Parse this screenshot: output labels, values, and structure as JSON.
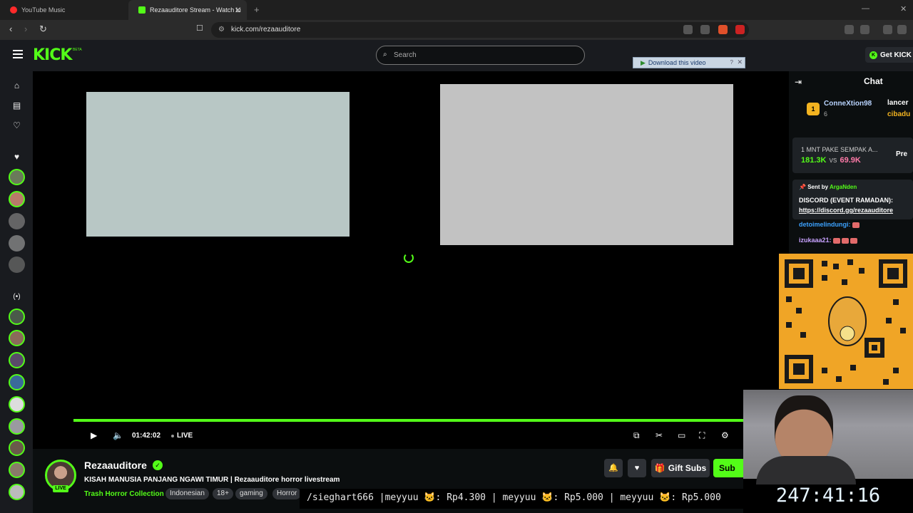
{
  "browser": {
    "tabs": [
      {
        "label": "YouTube Music"
      },
      {
        "label": "Rezaauditore Stream - Watch Li"
      }
    ],
    "url": "kick.com/rezaauditore"
  },
  "header": {
    "logo": "KICK",
    "beta": "BETA",
    "search_placeholder": "Search",
    "download_label": "Download this video",
    "get_kick": "Get KICK"
  },
  "player": {
    "time": "01:42:02",
    "live_label": "LIVE",
    "progress": 1.0
  },
  "stream": {
    "streamer": "Rezaauditore",
    "live_badge": "LIVE",
    "title": "KISAH MANUSIA PANJANG NGAWI TIMUR | Rezaauditore horror livestream",
    "category": "Trash Horror Collection",
    "tags": [
      "Indonesian",
      "18+",
      "gaming",
      "Horror"
    ],
    "gift_label": "Gift Subs",
    "sub_label": "Sub"
  },
  "chat": {
    "title": "Chat",
    "top_gifter": {
      "rank": "1",
      "name": "ConneXtion98",
      "count": "6"
    },
    "gifter2": "lancer",
    "gifter3": "cibadu",
    "prediction": {
      "question": "1 MNT PAKE SEMPAK A...",
      "left": "181.3K",
      "vs": "vs",
      "right": "69.9K",
      "button": "Pre"
    },
    "pinned": {
      "sent_by": "Sent by",
      "user": "ArgaNden",
      "line1": "DISCORD (EVENT RAMADAN):",
      "line2": "https://discord.gg/rezaauditore"
    },
    "messages": [
      {
        "user": "detoimelindungi:"
      },
      {
        "user": "izukaaa21:"
      }
    ]
  },
  "overlay": {
    "ticker": "/sieghart666 |meyyuu 🐱: Rp4.300 | meyyuu 🐱: Rp5.000 | meyyuu 🐱: Rp5.000",
    "clock": "247:41:16"
  },
  "colors": {
    "accent": "#53fc18",
    "bg": "#0b0e0f",
    "panel": "#191b1f"
  }
}
